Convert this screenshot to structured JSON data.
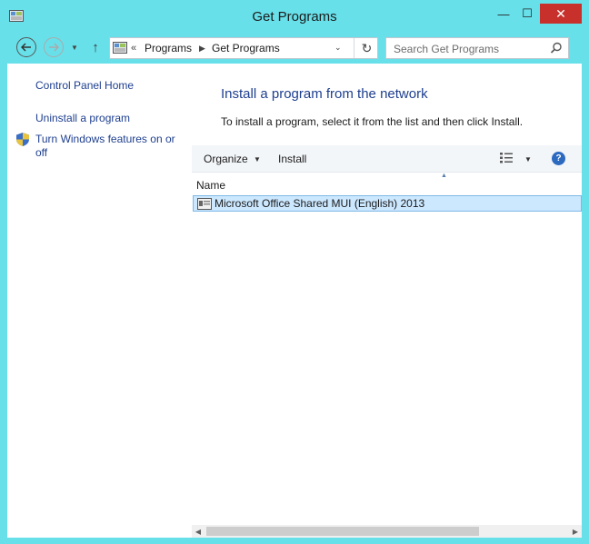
{
  "window": {
    "title": "Get Programs",
    "minimize_glyph": "—",
    "maximize_glyph": "☐",
    "close_glyph": "✕"
  },
  "nav": {
    "history_glyph": "▼",
    "up_glyph": "↑"
  },
  "address": {
    "overflow_glyph": "«",
    "crumbs": [
      "Programs",
      "Get Programs"
    ],
    "separator_glyph": "▶",
    "dropdown_glyph": "⌄",
    "refresh_glyph": "↻"
  },
  "search": {
    "placeholder": "Search Get Programs"
  },
  "left_pane": {
    "home": "Control Panel Home",
    "uninstall": "Uninstall a program",
    "features": "Turn Windows features on or off"
  },
  "main": {
    "heading": "Install a program from the network",
    "description": "To install a program, select it from the list and then click Install."
  },
  "toolbar": {
    "organize": "Organize",
    "dropdown_glyph": "▼",
    "install": "Install",
    "help_glyph": "?"
  },
  "list": {
    "sort_glyph": "▲",
    "column_name": "Name",
    "rows": [
      {
        "name": "Microsoft Office Shared MUI (English) 2013"
      }
    ]
  },
  "scrollbar": {
    "left_glyph": "◀",
    "right_glyph": "▶"
  },
  "icons": {
    "app": "control-panel-icon",
    "shield": "uac-shield-icon",
    "help": "help-icon",
    "view": "view-options-icon"
  }
}
